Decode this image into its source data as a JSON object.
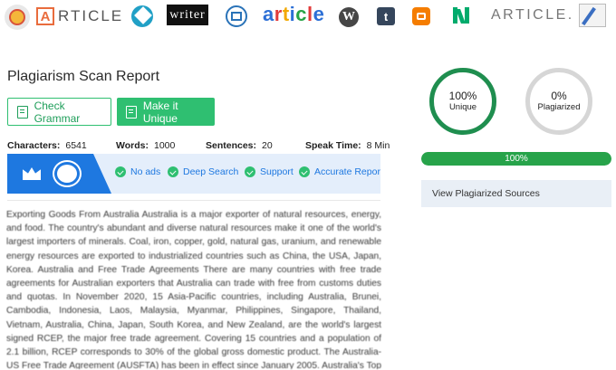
{
  "logos": {
    "article_logo_1": "RTICLE",
    "writer_logo": "writer",
    "article_logo_2": [
      "a",
      "r",
      "t",
      "i",
      "c",
      "l",
      "e"
    ],
    "wordpress_logo": "W",
    "tumblr_logo": "t",
    "article_logo_3": "ARTICLE."
  },
  "report": {
    "title": "Plagiarism Scan Report",
    "check_grammar_label": "Check Grammar",
    "make_unique_label": "Make it Unique"
  },
  "stats": {
    "characters_label": "Characters:",
    "characters_value": "6541",
    "words_label": "Words:",
    "words_value": "1000",
    "sentences_label": "Sentences:",
    "sentences_value": "20",
    "speak_time_label": "Speak Time:",
    "speak_time_value": "8 Min"
  },
  "features": [
    "No ads",
    "Deep Search",
    "Support",
    "Accurate Reports"
  ],
  "body_text": "Exporting Goods From Australia Australia is a major exporter of natural resources, energy, and food. The country's abundant and diverse natural resources make it one of the world's largest importers of minerals. Coal, iron, copper, gold, natural gas, uranium, and renewable energy resources are exported to industrialized countries such as China, the USA, Japan, Korea. Australia and Free Trade Agreements There are many countries with free trade agreements for Australian exporters that Australia can trade with free from customs duties and quotas. In November 2020, 15 Asia-Pacific countries, including Australia, Brunei, Cambodia, Indonesia, Laos, Malaysia, Myanmar, Philippines, Singapore, Thailand, Vietnam, Australia, China, Japan, South Korea, and New Zealand, are the world's largest signed RCEP, the major free trade agreement. Covering 15 countries and a population of 2.1 billion, RCEP corresponds to 30% of the global gross domestic product. The Australia-US Free Trade Agreement (AUSFTA) has been in effect since January 2005. Australia's Top Exports Although Australia is an oil-importing country, they are the world's largest coal and natural gas exporter. Ores",
  "results": {
    "unique_pct": "100%",
    "unique_label": "Unique",
    "plagiarized_pct": "0%",
    "plagiarized_label": "Plagiarized",
    "progress_value": 100,
    "progress_text": "100%",
    "view_sources_label": "View Plagiarized Sources"
  },
  "colors": {
    "accent_green": "#2fbf71",
    "unique_ring": "#1f8e4f",
    "banner_blue": "#1e78e0",
    "progress_fill": "#27a34a"
  }
}
